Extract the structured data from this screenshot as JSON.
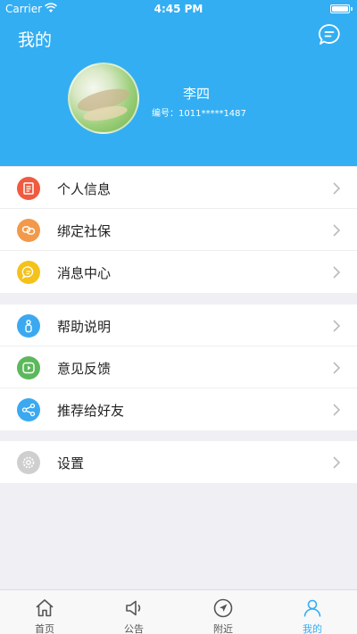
{
  "status_bar": {
    "carrier": "Carrier",
    "time": "4:45 PM",
    "battery_level": 1.0
  },
  "header": {
    "title": "我的",
    "message_icon": "chat-bubble-icon"
  },
  "profile": {
    "name": "李四",
    "id_text": "编号：1011*****1487"
  },
  "groups": [
    [
      {
        "label": "个人信息",
        "icon": "document-icon",
        "color": "#f05a3e"
      },
      {
        "label": "绑定社保",
        "icon": "link-icon",
        "color": "#f2994a"
      },
      {
        "label": "消息中心",
        "icon": "message-icon",
        "color": "#f5c21b"
      }
    ],
    [
      {
        "label": "帮助说明",
        "icon": "person-help-icon",
        "color": "#3ba9ef"
      },
      {
        "label": "意见反馈",
        "icon": "feedback-icon",
        "color": "#5cb85c"
      },
      {
        "label": "推荐给好友",
        "icon": "share-icon",
        "color": "#3ba9ef"
      }
    ],
    [
      {
        "label": "设置",
        "icon": "gear-icon",
        "color": "#cfcfcf"
      }
    ]
  ],
  "tabs": [
    {
      "label": "首页",
      "icon": "home-icon",
      "active": false
    },
    {
      "label": "公告",
      "icon": "speaker-icon",
      "active": false
    },
    {
      "label": "附近",
      "icon": "navigation-icon",
      "active": false
    },
    {
      "label": "我的",
      "icon": "user-icon",
      "active": true
    }
  ],
  "colors": {
    "primary": "#33aef2",
    "background": "#efeff4"
  }
}
